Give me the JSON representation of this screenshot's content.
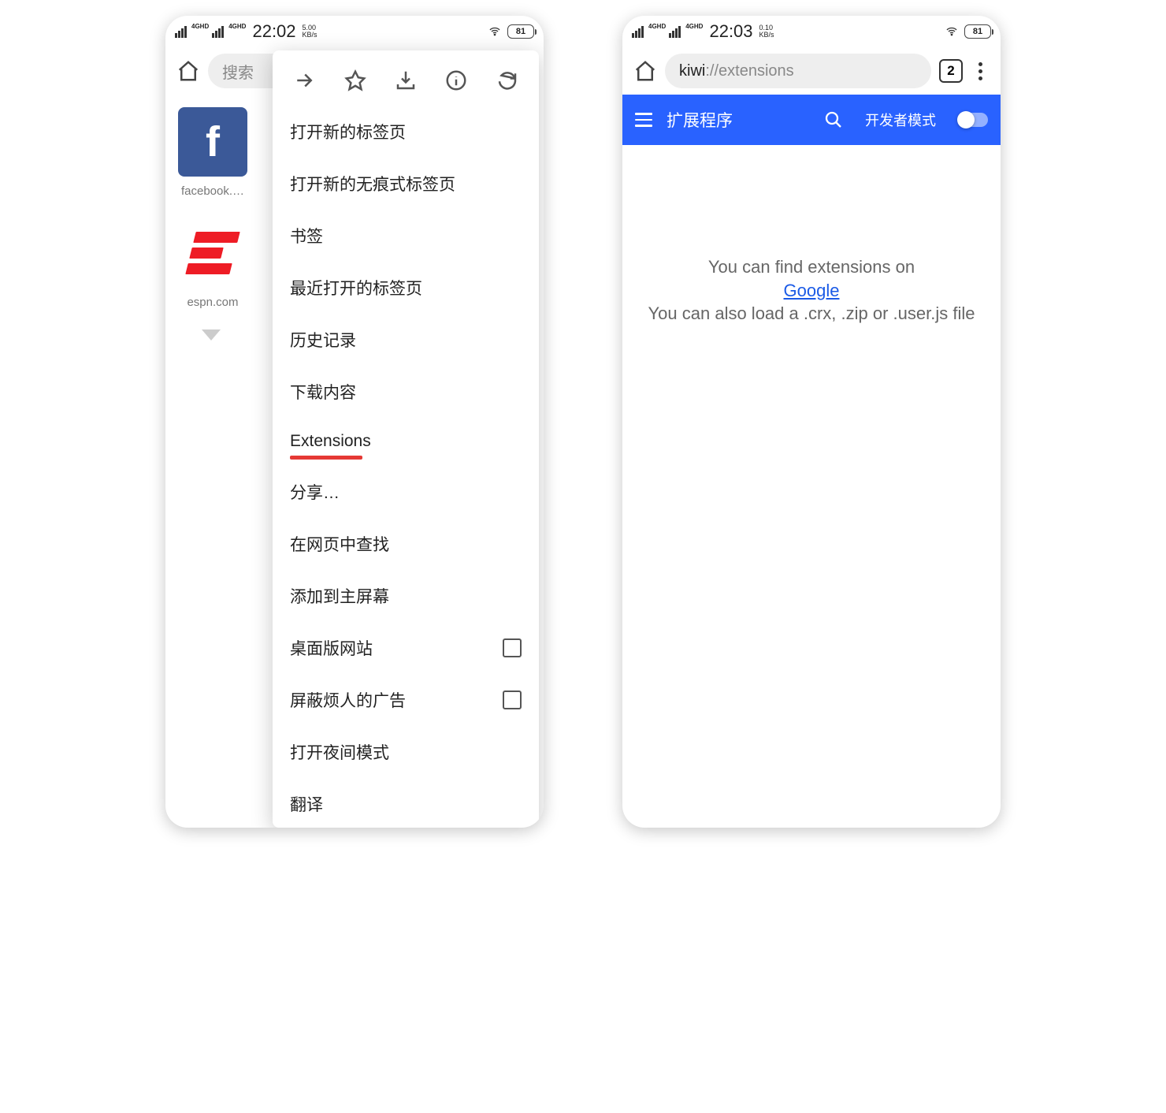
{
  "left": {
    "status": {
      "net_label": "4GHD",
      "time": "22:02",
      "speed_top": "5.00",
      "speed_bot": "KB/s",
      "battery": "81"
    },
    "search_placeholder": "搜索",
    "tiles": [
      {
        "label": "facebook.…"
      },
      {
        "label": "espn.com"
      }
    ],
    "menu_items": [
      {
        "label": "打开新的标签页",
        "checkbox": false
      },
      {
        "label": "打开新的无痕式标签页",
        "checkbox": false
      },
      {
        "label": "书签",
        "checkbox": false
      },
      {
        "label": "最近打开的标签页",
        "checkbox": false
      },
      {
        "label": "历史记录",
        "checkbox": false
      },
      {
        "label": "下载内容",
        "checkbox": false
      },
      {
        "label": "Extensions",
        "checkbox": false,
        "underline": true
      },
      {
        "label": "分享…",
        "checkbox": false
      },
      {
        "label": "在网页中查找",
        "checkbox": false
      },
      {
        "label": "添加到主屏幕",
        "checkbox": false
      },
      {
        "label": "桌面版网站",
        "checkbox": true
      },
      {
        "label": "屏蔽烦人的广告",
        "checkbox": true
      },
      {
        "label": "打开夜间模式",
        "checkbox": false
      },
      {
        "label": "翻译",
        "checkbox": false
      }
    ]
  },
  "right": {
    "status": {
      "net_label": "4GHD",
      "time": "22:03",
      "speed_top": "0.10",
      "speed_bot": "KB/s",
      "battery": "81"
    },
    "url_prefix": "kiwi",
    "url_rest": "://extensions",
    "tab_count": "2",
    "ext_header_title": "扩展程序",
    "dev_mode_label": "开发者模式",
    "body_line1": "You can find extensions on",
    "body_link": "Google",
    "body_line2": "You can also load a .crx, .zip or .user.js file"
  }
}
